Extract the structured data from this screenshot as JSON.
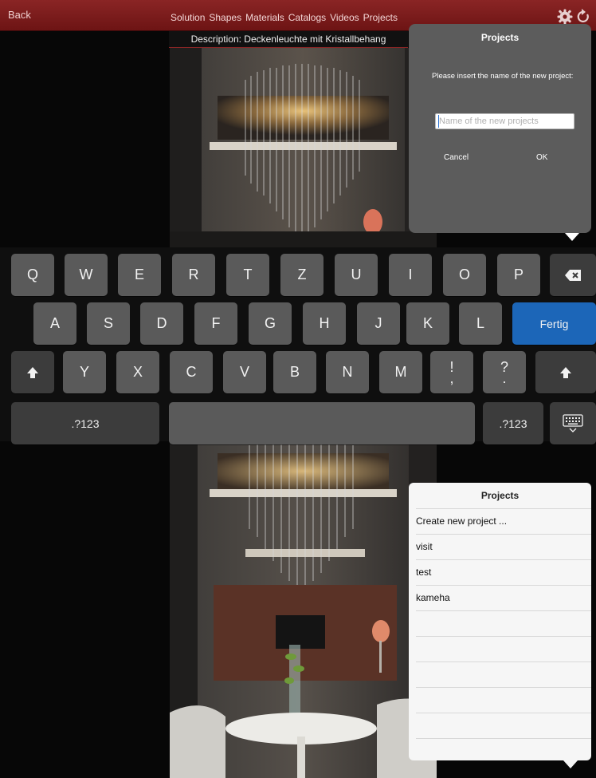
{
  "topbar": {
    "back_label": "Back",
    "nav": [
      "Solution",
      "Shapes",
      "Materials",
      "Catalogs",
      "Videos",
      "Projects"
    ],
    "gear_icon": "gear-icon",
    "refresh_icon": "refresh-icon"
  },
  "description": "Description: Deckenleuchte mit Kristallbehang",
  "new_project_popover": {
    "title": "Projects",
    "message": "Please insert the name of the new project:",
    "input_placeholder": "Name of the new projects",
    "input_value": "",
    "cancel_label": "Cancel",
    "ok_label": "OK"
  },
  "keyboard": {
    "row1": [
      "Q",
      "W",
      "E",
      "R",
      "T",
      "Z",
      "U",
      "I",
      "O",
      "P"
    ],
    "row2": [
      "A",
      "S",
      "D",
      "F",
      "G",
      "H",
      "J",
      "K",
      "L"
    ],
    "row3": [
      "Y",
      "X",
      "C",
      "V",
      "B",
      "N",
      "M"
    ],
    "punct1_top": "!",
    "punct1_bottom": ",",
    "punct2_top": "?",
    "punct2_bottom": ".",
    "done_label": "Fertig",
    "numbers_label": ".?123",
    "shift_icon": "shift-icon",
    "backspace_icon": "backspace-icon",
    "hide_keyboard_icon": "keyboard-hide-icon"
  },
  "projects_list": {
    "title": "Projects",
    "items": [
      "Create new project ...",
      "visit",
      "test",
      "kameha"
    ]
  },
  "colors": {
    "topbar": "#7a1a1a",
    "done_key": "#1c66b8",
    "popover_dark": "#5c5c5c",
    "popover_light": "#f6f6f6"
  }
}
